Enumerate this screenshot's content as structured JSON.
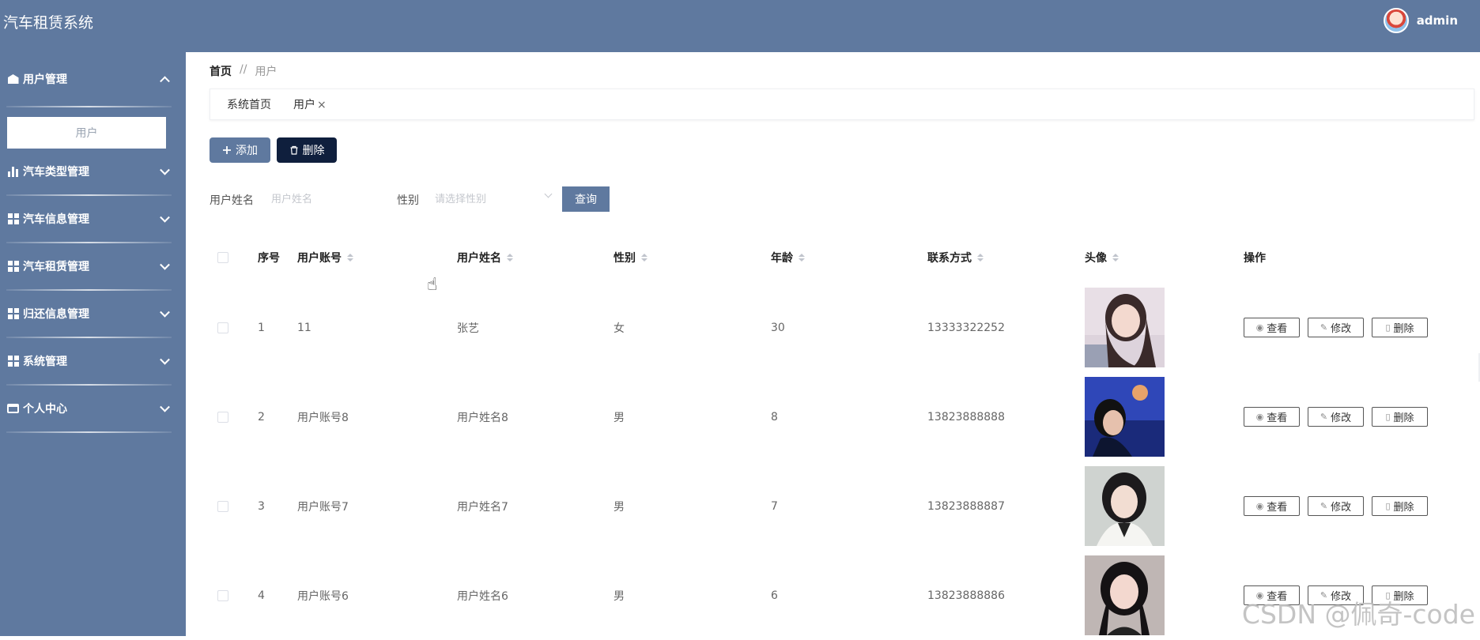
{
  "app": {
    "title": "汽车租赁系统",
    "user": "admin"
  },
  "sidebar": {
    "groups": [
      {
        "label": "用户管理",
        "icon": "home-icon",
        "expanded": true,
        "children": [
          "用户"
        ]
      },
      {
        "label": "汽车类型管理",
        "icon": "bar-chart-icon",
        "expanded": false
      },
      {
        "label": "汽车信息管理",
        "icon": "grid-icon",
        "expanded": false
      },
      {
        "label": "汽车租赁管理",
        "icon": "grid-icon",
        "expanded": false
      },
      {
        "label": "归还信息管理",
        "icon": "grid-icon",
        "expanded": false
      },
      {
        "label": "系统管理",
        "icon": "grid-icon",
        "expanded": false
      },
      {
        "label": "个人中心",
        "icon": "card-icon",
        "expanded": false
      }
    ]
  },
  "breadcrumb": {
    "home": "首页",
    "sep": "//",
    "current": "用户"
  },
  "tabs": [
    {
      "label": "系统首页"
    },
    {
      "label": "用户",
      "close": "×"
    }
  ],
  "toolbar": {
    "add_label": "添加",
    "delete_label": "删除",
    "add_icon": "plus-icon",
    "delete_icon": "trash-icon"
  },
  "filters": {
    "name_label": "用户姓名",
    "name_placeholder": "用户姓名",
    "gender_label": "性别",
    "gender_placeholder": "请选择性别",
    "query_label": "查询"
  },
  "table": {
    "headers": {
      "index": "序号",
      "account": "用户账号",
      "name": "用户姓名",
      "gender": "性别",
      "age": "年龄",
      "phone": "联系方式",
      "avatar": "头像",
      "ops": "操作"
    },
    "rows": [
      {
        "index": "1",
        "account": "11",
        "name": "张艺",
        "gender": "女",
        "age": "30",
        "phone": "13333322252"
      },
      {
        "index": "2",
        "account": "用户账号8",
        "name": "用户姓名8",
        "gender": "男",
        "age": "8",
        "phone": "13823888888"
      },
      {
        "index": "3",
        "account": "用户账号7",
        "name": "用户姓名7",
        "gender": "男",
        "age": "7",
        "phone": "13823888887"
      },
      {
        "index": "4",
        "account": "用户账号6",
        "name": "用户姓名6",
        "gender": "男",
        "age": "6",
        "phone": "13823888886"
      }
    ],
    "ops": {
      "view": "查看",
      "edit": "修改",
      "delete": "删除"
    }
  },
  "watermark": "CSDN @佩奇-code",
  "colors": {
    "primary": "#5f799f",
    "danger_dark": "#0f1f3d"
  }
}
